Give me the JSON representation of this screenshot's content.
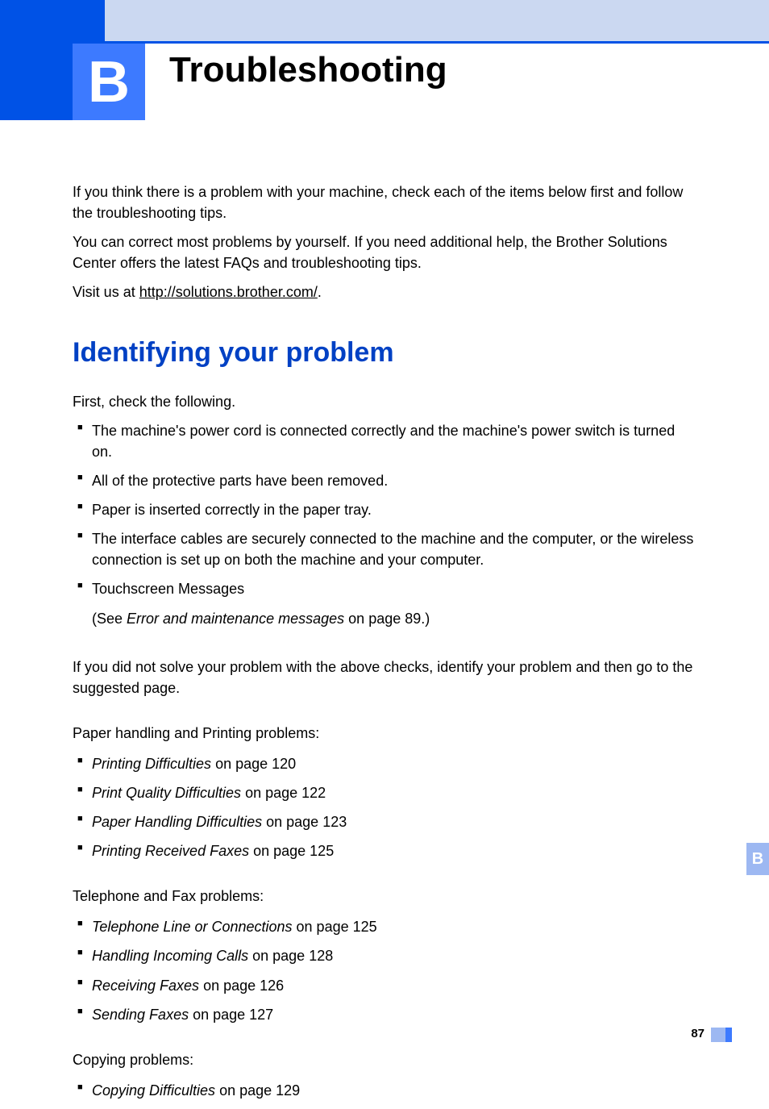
{
  "chapter": {
    "letter": "B",
    "title": "Troubleshooting"
  },
  "intro": {
    "p1": "If you think there is a problem with your machine, check each of the items below first and follow the troubleshooting tips.",
    "p2": "You can correct most problems by yourself. If you need additional help, the Brother Solutions Center offers the latest FAQs and troubleshooting tips.",
    "p3_prefix": "Visit us at ",
    "p3_link": "http://solutions.brother.com/",
    "p3_suffix": "."
  },
  "section_heading": "Identifying your problem",
  "lead": "First, check the following.",
  "checks": [
    "The machine's power cord is connected correctly and the machine's power switch is turned on.",
    "All of the protective parts have been removed.",
    "Paper is inserted correctly in the paper tray.",
    "The interface cables are securely connected to the machine and the computer, or the wireless connection is set up on both the machine and your computer.",
    "Touchscreen Messages"
  ],
  "check_sub_prefix": "(See ",
  "check_sub_italic": "Error and maintenance messages",
  "check_sub_suffix": " on page 89.)",
  "post_check": "If you did not solve your problem with the above checks, identify your problem and then go to the suggested page.",
  "groups": [
    {
      "heading": "Paper handling and Printing problems:",
      "items": [
        {
          "title": "Printing Difficulties",
          "page": "120"
        },
        {
          "title": "Print Quality Difficulties",
          "page": "122"
        },
        {
          "title": "Paper Handling Difficulties",
          "page": "123"
        },
        {
          "title": "Printing Received Faxes",
          "page": "125"
        }
      ]
    },
    {
      "heading": "Telephone and Fax problems:",
      "items": [
        {
          "title": "Telephone Line or Connections",
          "page": "125"
        },
        {
          "title": "Handling Incoming Calls",
          "page": "128"
        },
        {
          "title": "Receiving Faxes",
          "page": "126"
        },
        {
          "title": "Sending Faxes",
          "page": "127"
        }
      ]
    },
    {
      "heading": "Copying problems:",
      "items": [
        {
          "title": "Copying Difficulties",
          "page": "129"
        }
      ]
    }
  ],
  "side_tab": "B",
  "page_number": "87",
  "on_page": " on page "
}
